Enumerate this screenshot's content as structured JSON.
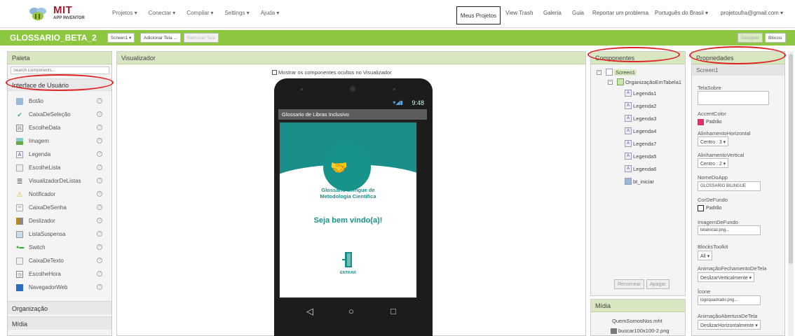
{
  "brand": {
    "name": "MIT",
    "sub": "APP INVENTOR"
  },
  "nav": {
    "left": [
      "Projetos ▾",
      "Conectar ▾",
      "Compilar ▾",
      "Settings ▾",
      "Ajuda ▾"
    ],
    "meus_projetos": "Meus Projetos",
    "right": [
      "View Trash",
      "Galeria",
      "Guia",
      "Reportar um problema",
      "Português do Brasil ▾",
      "projetoufra@gmail.com ▾"
    ]
  },
  "project": {
    "name": "GLOSSARIO_BETA_2",
    "screen_select": "Screen1 ▾",
    "add_screen": "Adicionar Tela ...",
    "remove_screen": "Remover Tela",
    "designer": "Designer",
    "blocks": "Blocos"
  },
  "palette": {
    "title": "Paleta",
    "search_placeholder": "Search Components...",
    "ui_section": "Interface de Usuário",
    "items": [
      {
        "label": "Botão",
        "icon": "button-icon"
      },
      {
        "label": "CaixaDeSeleção",
        "icon": "checkbox-icon"
      },
      {
        "label": "EscolheData",
        "icon": "datepicker-icon"
      },
      {
        "label": "Imagem",
        "icon": "image-icon"
      },
      {
        "label": "Legenda",
        "icon": "label-icon"
      },
      {
        "label": "EscolheLista",
        "icon": "listpicker-icon"
      },
      {
        "label": "VisualizadorDeListas",
        "icon": "listview-icon"
      },
      {
        "label": "Notificador",
        "icon": "notifier-icon"
      },
      {
        "label": "CaixaDeSenha",
        "icon": "passwordbox-icon"
      },
      {
        "label": "Deslizador",
        "icon": "slider-icon"
      },
      {
        "label": "ListaSuspensa",
        "icon": "spinner-icon"
      },
      {
        "label": "Switch",
        "icon": "switch-icon"
      },
      {
        "label": "CaixaDeTexto",
        "icon": "textbox-icon"
      },
      {
        "label": "EscolheHora",
        "icon": "timepicker-icon"
      },
      {
        "label": "NavegadorWeb",
        "icon": "webviewer-icon"
      }
    ],
    "help": "?",
    "sections": [
      "Organização",
      "Mídia"
    ]
  },
  "viewer": {
    "title": "Visualizador",
    "show_hidden": "Mostrar os componentes ocultos no Visualizador",
    "status_time": "9:48",
    "screen_title": "Glossario de Libras Inclusivo",
    "app_title_line1": "Glossário bilíngue de",
    "app_title_line2": "Metodologia Científica",
    "welcome": "Seja bem vindo(a)!",
    "enter": "ENTRAR"
  },
  "components": {
    "title": "Componentes",
    "root": "Screen1",
    "table": "OrganizaçãoEmTabela1",
    "children": [
      "Legenda1",
      "Legenda2",
      "Legenda3",
      "Legenda4",
      "Legenda7",
      "Legenda5",
      "Legenda6"
    ],
    "button": "bt_iniciar",
    "rename": "Renomear",
    "delete": "Apagar"
  },
  "media": {
    "title": "Mídia",
    "files": [
      "QuemSomosNos.mht",
      "buscar100x100-2.png"
    ]
  },
  "properties": {
    "title": "Propriedades",
    "subject": "Screen1",
    "tela_sobre": "TelaSobre",
    "accent_label": "AccentColor",
    "accent_value": "Padrão",
    "accent_color": "#e0306b",
    "align_h_label": "AlinhamentoHorizontal",
    "align_h_value": "Centro : 3 ▾",
    "align_v_label": "AlinhamentoVertical",
    "align_v_value": "Centro : 2 ▾",
    "app_name_label": "NomeDoApp",
    "app_name_value": "GLOSSARIO BILINGUE",
    "bg_label": "CorDeFundo",
    "bg_value": "Padrão",
    "bgimg_label": "ImagemDeFundo",
    "bgimg_value": "telainicial.png...",
    "toolkit_label": "BlocksToolkit",
    "toolkit_value": "All ▾",
    "close_anim_label": "AnimaçãoFechamentoDeTela",
    "close_anim_value": "DeslizarVerticalmente ▾",
    "icon_label": "Ícone",
    "icon_value": "logoquadrado.png...",
    "open_anim_label": "AnimaçãoAberturaDeTela",
    "open_anim_value": "DeslizarHorizontalmente ▾"
  }
}
